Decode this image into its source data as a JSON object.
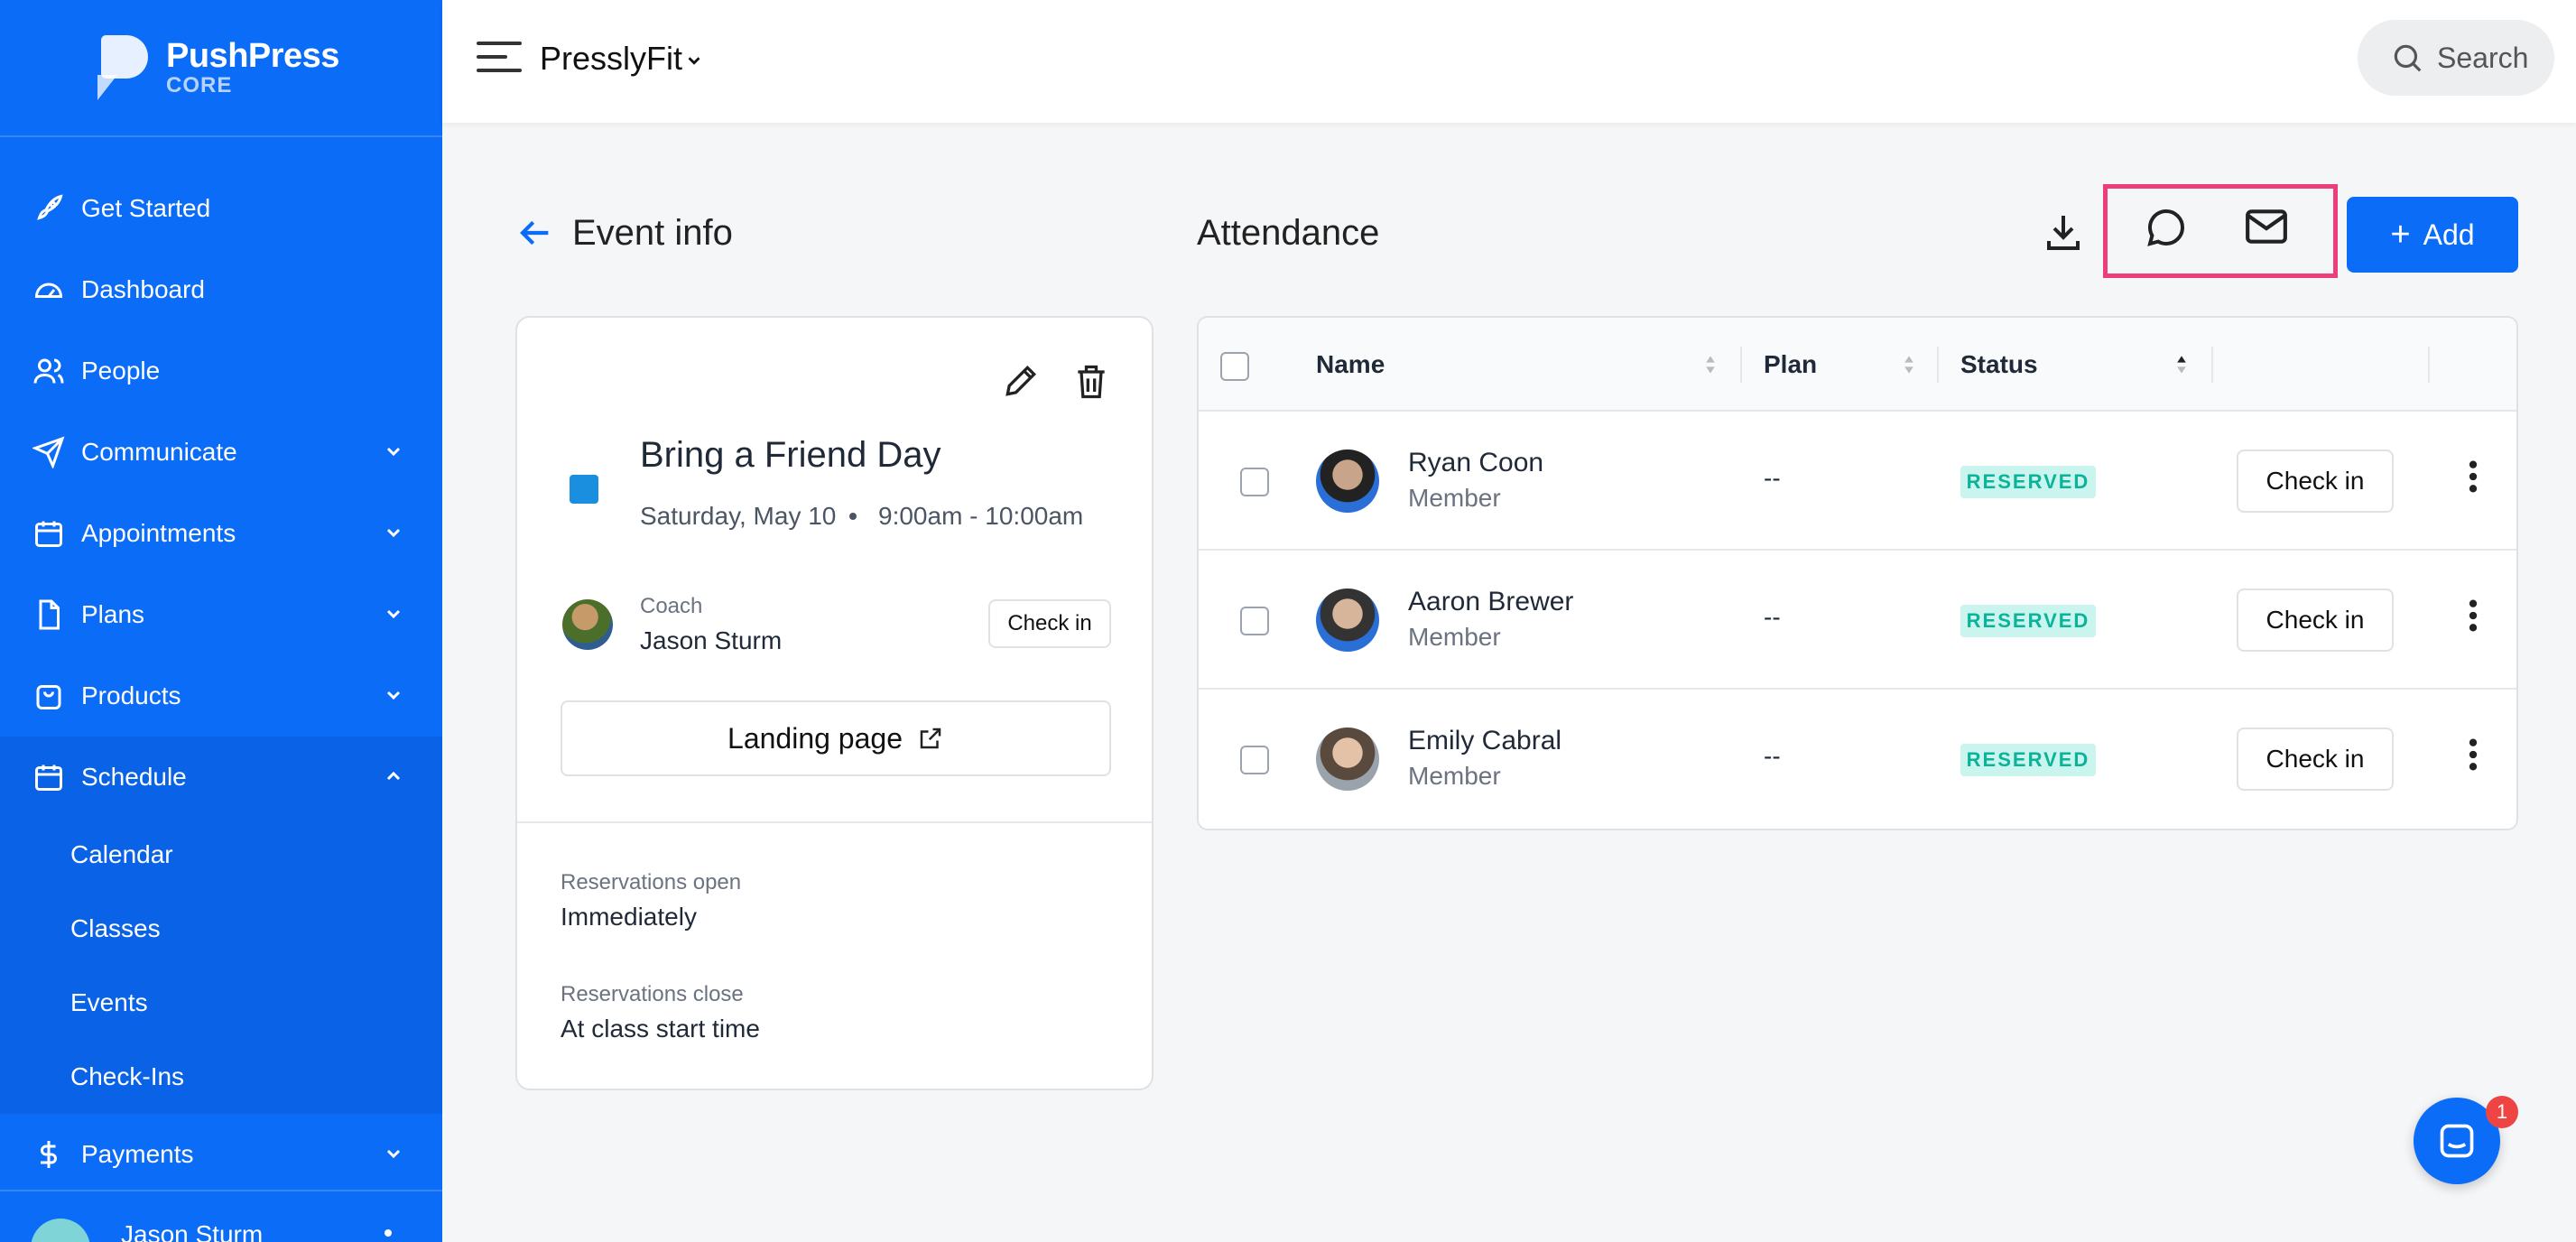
{
  "brand": {
    "name": "PushPress",
    "sub": "CORE"
  },
  "sidebar": {
    "items": [
      {
        "label": "Get Started",
        "icon": "rocket-icon"
      },
      {
        "label": "Dashboard",
        "icon": "gauge-icon"
      },
      {
        "label": "People",
        "icon": "people-icon"
      },
      {
        "label": "Communicate",
        "icon": "send-icon"
      },
      {
        "label": "Appointments",
        "icon": "calendar-icon"
      },
      {
        "label": "Plans",
        "icon": "document-icon"
      },
      {
        "label": "Products",
        "icon": "bag-icon"
      },
      {
        "label": "Schedule",
        "icon": "calendar-icon"
      },
      {
        "label": "Payments",
        "icon": "dollar-icon"
      }
    ],
    "schedule_sub": [
      "Calendar",
      "Classes",
      "Events",
      "Check-Ins"
    ],
    "user": "Jason Sturm"
  },
  "topbar": {
    "gym": "PresslyFit",
    "search_label": "Search"
  },
  "event": {
    "heading": "Event info",
    "title": "Bring a Friend Day",
    "date": "Saturday, May 10",
    "time": "9:00am - 10:00am",
    "color": "#1a8fe0",
    "coach_label": "Coach",
    "coach_name": "Jason Sturm",
    "checkin_label": "Check in",
    "landing_label": "Landing page",
    "res_open_label": "Reservations open",
    "res_open_value": "Immediately",
    "res_close_label": "Reservations close",
    "res_close_value": "At class start time"
  },
  "attendance": {
    "heading": "Attendance",
    "add_label": "Add",
    "columns": [
      "Name",
      "Plan",
      "Status"
    ],
    "rows": [
      {
        "name": "Ryan Coon",
        "sub": "Member",
        "plan": "--",
        "status": "RESERVED",
        "action": "Check in"
      },
      {
        "name": "Aaron Brewer",
        "sub": "Member",
        "plan": "--",
        "status": "RESERVED",
        "action": "Check in"
      },
      {
        "name": "Emily Cabral",
        "sub": "Member",
        "plan": "--",
        "status": "RESERVED",
        "action": "Check in"
      }
    ]
  },
  "chat_badge": "1",
  "colors": {
    "primary": "#0b6cf8",
    "highlight": "#ee3e7a",
    "badge_bg": "#c9f5ee",
    "badge_text": "#0bb39a"
  }
}
